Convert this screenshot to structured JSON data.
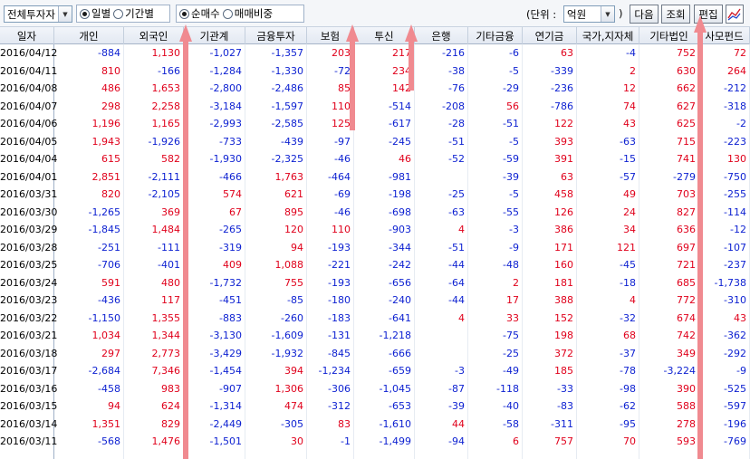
{
  "toolbar": {
    "investor_select": "전체투자자",
    "period_options": [
      {
        "label": "일별",
        "selected": true
      },
      {
        "label": "기간별",
        "selected": false
      }
    ],
    "mode_options": [
      {
        "label": "순매수",
        "selected": true
      },
      {
        "label": "매매비중",
        "selected": false
      }
    ],
    "unit_label": "(단위 :",
    "unit_value": "억원",
    "unit_close": ")",
    "next_label": "다음",
    "query_label": "조회",
    "edit_label": "편집"
  },
  "colors": {
    "positive": "#e0001b",
    "negative": "#0b1fd1",
    "arrow": "#f08a90"
  },
  "table": {
    "columns": [
      "일자",
      "개인",
      "외국인",
      "기관계",
      "금융투자",
      "보험",
      "투신",
      "은행",
      "기타금융",
      "연기금",
      "국가,지자체",
      "기타법인",
      "사모펀드"
    ],
    "rows": [
      [
        "2016/04/12",
        "-884",
        "1,130",
        "-1,027",
        "-1,357",
        "203",
        "217",
        "-216",
        "-6",
        "63",
        "-4",
        "752",
        "72"
      ],
      [
        "2016/04/11",
        "810",
        "-166",
        "-1,284",
        "-1,330",
        "-72",
        "234",
        "-38",
        "-5",
        "-339",
        "2",
        "630",
        "264"
      ],
      [
        "2016/04/08",
        "486",
        "1,653",
        "-2,800",
        "-2,486",
        "85",
        "142",
        "-76",
        "-29",
        "-236",
        "12",
        "662",
        "-212"
      ],
      [
        "2016/04/07",
        "298",
        "2,258",
        "-3,184",
        "-1,597",
        "110",
        "-514",
        "-208",
        "56",
        "-786",
        "74",
        "627",
        "-318"
      ],
      [
        "2016/04/06",
        "1,196",
        "1,165",
        "-2,993",
        "-2,585",
        "125",
        "-617",
        "-28",
        "-51",
        "122",
        "43",
        "625",
        "-2"
      ],
      [
        "2016/04/05",
        "1,943",
        "-1,926",
        "-733",
        "-439",
        "-97",
        "-245",
        "-51",
        "-5",
        "393",
        "-63",
        "715",
        "-223"
      ],
      [
        "2016/04/04",
        "615",
        "582",
        "-1,930",
        "-2,325",
        "-46",
        "46",
        "-52",
        "-59",
        "391",
        "-15",
        "741",
        "130"
      ],
      [
        "2016/04/01",
        "2,851",
        "-2,111",
        "-466",
        "1,763",
        "-464",
        "-981",
        "",
        "-39",
        "63",
        "-57",
        "-279",
        "-750"
      ],
      [
        "2016/03/31",
        "820",
        "-2,105",
        "574",
        "621",
        "-69",
        "-198",
        "-25",
        "-5",
        "458",
        "49",
        "703",
        "-255"
      ],
      [
        "2016/03/30",
        "-1,265",
        "369",
        "67",
        "895",
        "-46",
        "-698",
        "-63",
        "-55",
        "126",
        "24",
        "827",
        "-114"
      ],
      [
        "2016/03/29",
        "-1,845",
        "1,484",
        "-265",
        "120",
        "110",
        "-903",
        "4",
        "-3",
        "386",
        "34",
        "636",
        "-12"
      ],
      [
        "2016/03/28",
        "-251",
        "-111",
        "-319",
        "94",
        "-193",
        "-344",
        "-51",
        "-9",
        "171",
        "121",
        "697",
        "-107"
      ],
      [
        "2016/03/25",
        "-706",
        "-401",
        "409",
        "1,088",
        "-221",
        "-242",
        "-44",
        "-48",
        "160",
        "-45",
        "721",
        "-237"
      ],
      [
        "2016/03/24",
        "591",
        "480",
        "-1,732",
        "755",
        "-193",
        "-656",
        "-64",
        "2",
        "181",
        "-18",
        "685",
        "-1,738"
      ],
      [
        "2016/03/23",
        "-436",
        "117",
        "-451",
        "-85",
        "-180",
        "-240",
        "-44",
        "17",
        "388",
        "4",
        "772",
        "-310"
      ],
      [
        "2016/03/22",
        "-1,150",
        "1,355",
        "-883",
        "-260",
        "-183",
        "-641",
        "4",
        "33",
        "152",
        "-32",
        "674",
        "43"
      ],
      [
        "2016/03/21",
        "1,034",
        "1,344",
        "-3,130",
        "-1,609",
        "-131",
        "-1,218",
        "",
        "-75",
        "198",
        "68",
        "742",
        "-362"
      ],
      [
        "2016/03/18",
        "297",
        "2,773",
        "-3,429",
        "-1,932",
        "-845",
        "-666",
        "",
        "-25",
        "372",
        "-37",
        "349",
        "-292"
      ],
      [
        "2016/03/17",
        "-2,684",
        "7,346",
        "-1,454",
        "394",
        "-1,234",
        "-659",
        "-3",
        "-49",
        "185",
        "-78",
        "-3,224",
        "-9"
      ],
      [
        "2016/03/16",
        "-458",
        "983",
        "-907",
        "1,306",
        "-306",
        "-1,045",
        "-87",
        "-118",
        "-33",
        "-98",
        "390",
        "-525"
      ],
      [
        "2016/03/15",
        "94",
        "624",
        "-1,314",
        "474",
        "-312",
        "-653",
        "-39",
        "-40",
        "-83",
        "-62",
        "588",
        "-597"
      ],
      [
        "2016/03/14",
        "1,351",
        "829",
        "-2,449",
        "-305",
        "83",
        "-1,610",
        "44",
        "-58",
        "-311",
        "-95",
        "278",
        "-196"
      ],
      [
        "2016/03/11",
        "-568",
        "1,476",
        "-1,501",
        "30",
        "-1",
        "-1,499",
        "-94",
        "6",
        "757",
        "70",
        "593",
        "-769"
      ],
      [
        "",
        "",
        "",
        "",
        "",
        "",
        "",
        "",
        "",
        "",
        "",
        "",
        ""
      ]
    ]
  }
}
